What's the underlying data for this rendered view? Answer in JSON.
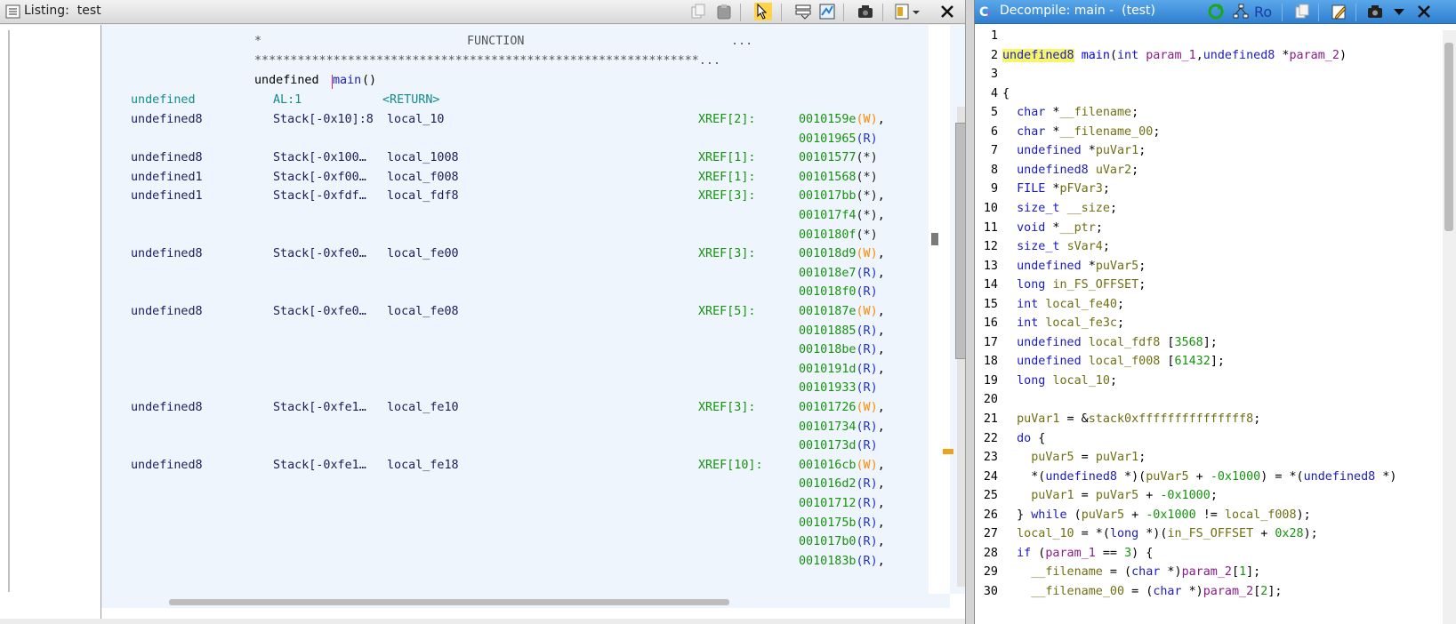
{
  "listing": {
    "title": "Listing:  test",
    "header": {
      "star": "*",
      "function_label": "FUNCTION",
      "ellipsis": "...",
      "stars": "**************************************************************...",
      "signature_ret": "undefined ",
      "signature_name": "main",
      "signature_params": "()"
    },
    "return_row": {
      "type": "undefined",
      "storage": "AL:1",
      "name": "<RETURN>"
    },
    "vars": [
      {
        "type": "undefined8",
        "stack": "Stack[-0x10]:8",
        "name": "local_10",
        "xref": "XREF[2]:",
        "refs": [
          {
            "addr": "0010159e",
            "acc": "(W)",
            "sep": ","
          },
          {
            "addr": "00101965",
            "acc": "(R)",
            "sep": ""
          }
        ]
      },
      {
        "type": "undefined8",
        "stack": "Stack[-0x100…",
        "name": "local_1008",
        "xref": "XREF[1]:",
        "refs": [
          {
            "addr": "00101577",
            "acc": "(*)",
            "sep": ""
          }
        ]
      },
      {
        "type": "undefined1",
        "stack": "Stack[-0xf00…",
        "name": "local_f008",
        "xref": "XREF[1]:",
        "refs": [
          {
            "addr": "00101568",
            "acc": "(*)",
            "sep": ""
          }
        ]
      },
      {
        "type": "undefined1",
        "stack": "Stack[-0xfdf…",
        "name": "local_fdf8",
        "xref": "XREF[3]:",
        "refs": [
          {
            "addr": "001017bb",
            "acc": "(*)",
            "sep": ","
          },
          {
            "addr": "001017f4",
            "acc": "(*)",
            "sep": ","
          },
          {
            "addr": "0010180f",
            "acc": "(*)",
            "sep": ""
          }
        ]
      },
      {
        "type": "undefined8",
        "stack": "Stack[-0xfe0…",
        "name": "local_fe00",
        "xref": "XREF[3]:",
        "refs": [
          {
            "addr": "001018d9",
            "acc": "(W)",
            "sep": ","
          },
          {
            "addr": "001018e7",
            "acc": "(R)",
            "sep": ","
          },
          {
            "addr": "001018f0",
            "acc": "(R)",
            "sep": ""
          }
        ]
      },
      {
        "type": "undefined8",
        "stack": "Stack[-0xfe0…",
        "name": "local_fe08",
        "xref": "XREF[5]:",
        "refs": [
          {
            "addr": "0010187e",
            "acc": "(W)",
            "sep": ","
          },
          {
            "addr": "00101885",
            "acc": "(R)",
            "sep": ","
          },
          {
            "addr": "001018be",
            "acc": "(R)",
            "sep": ","
          },
          {
            "addr": "0010191d",
            "acc": "(R)",
            "sep": ","
          },
          {
            "addr": "00101933",
            "acc": "(R)",
            "sep": ""
          }
        ]
      },
      {
        "type": "undefined8",
        "stack": "Stack[-0xfe1…",
        "name": "local_fe10",
        "xref": "XREF[3]:",
        "refs": [
          {
            "addr": "00101726",
            "acc": "(W)",
            "sep": ","
          },
          {
            "addr": "00101734",
            "acc": "(R)",
            "sep": ","
          },
          {
            "addr": "0010173d",
            "acc": "(R)",
            "sep": ""
          }
        ]
      },
      {
        "type": "undefined8",
        "stack": "Stack[-0xfe1…",
        "name": "local_fe18",
        "xref": "XREF[10]:",
        "refs": [
          {
            "addr": "001016cb",
            "acc": "(W)",
            "sep": ","
          },
          {
            "addr": "001016d2",
            "acc": "(R)",
            "sep": ","
          },
          {
            "addr": "00101712",
            "acc": "(R)",
            "sep": ","
          },
          {
            "addr": "0010175b",
            "acc": "(R)",
            "sep": ","
          },
          {
            "addr": "001017b0",
            "acc": "(R)",
            "sep": ","
          },
          {
            "addr": "0010183b",
            "acc": "(R)",
            "sep": ","
          }
        ]
      }
    ]
  },
  "decompile": {
    "title": "Decompile: main -  (test)",
    "lines": [
      "1",
      "2",
      "3",
      "4",
      "5",
      "6",
      "7",
      "8",
      "9",
      "10",
      "11",
      "12",
      "13",
      "14",
      "15",
      "16",
      "17",
      "18",
      "19",
      "20",
      "21",
      "22",
      "23",
      "24",
      "25",
      "26",
      "27",
      "28",
      "29",
      "30"
    ],
    "code": [
      [],
      [
        [
          "undefined8",
          "k hl"
        ],
        [
          " ",
          ""
        ],
        [
          "main",
          "f"
        ],
        [
          "(",
          ""
        ],
        [
          "int",
          "k"
        ],
        [
          " ",
          ""
        ],
        [
          "param_1",
          "p"
        ],
        [
          ",",
          ""
        ],
        [
          "undefined8",
          "k"
        ],
        [
          " *",
          ""
        ],
        [
          "param_2",
          "p"
        ],
        [
          ")",
          ""
        ]
      ],
      [],
      [
        [
          "{",
          ""
        ]
      ],
      [
        [
          "  ",
          ""
        ],
        [
          "char",
          "k"
        ],
        [
          " *",
          ""
        ],
        [
          "__filename",
          "v"
        ],
        [
          ";",
          ""
        ]
      ],
      [
        [
          "  ",
          ""
        ],
        [
          "char",
          "k"
        ],
        [
          " *",
          ""
        ],
        [
          "__filename_00",
          "v"
        ],
        [
          ";",
          ""
        ]
      ],
      [
        [
          "  ",
          ""
        ],
        [
          "undefined",
          "k"
        ],
        [
          " *",
          ""
        ],
        [
          "puVar1",
          "v"
        ],
        [
          ";",
          ""
        ]
      ],
      [
        [
          "  ",
          ""
        ],
        [
          "undefined8",
          "k"
        ],
        [
          " ",
          ""
        ],
        [
          "uVar2",
          "v"
        ],
        [
          ";",
          ""
        ]
      ],
      [
        [
          "  ",
          ""
        ],
        [
          "FILE",
          "k"
        ],
        [
          " *",
          ""
        ],
        [
          "pFVar3",
          "v"
        ],
        [
          ";",
          ""
        ]
      ],
      [
        [
          "  ",
          ""
        ],
        [
          "size_t",
          "k"
        ],
        [
          " ",
          ""
        ],
        [
          "__size",
          "v"
        ],
        [
          ";",
          ""
        ]
      ],
      [
        [
          "  ",
          ""
        ],
        [
          "void",
          "k"
        ],
        [
          " *",
          ""
        ],
        [
          "__ptr",
          "v"
        ],
        [
          ";",
          ""
        ]
      ],
      [
        [
          "  ",
          ""
        ],
        [
          "size_t",
          "k"
        ],
        [
          " ",
          ""
        ],
        [
          "sVar4",
          "v"
        ],
        [
          ";",
          ""
        ]
      ],
      [
        [
          "  ",
          ""
        ],
        [
          "undefined",
          "k"
        ],
        [
          " *",
          ""
        ],
        [
          "puVar5",
          "v"
        ],
        [
          ";",
          ""
        ]
      ],
      [
        [
          "  ",
          ""
        ],
        [
          "long",
          "k"
        ],
        [
          " ",
          ""
        ],
        [
          "in_FS_OFFSET",
          "v"
        ],
        [
          ";",
          ""
        ]
      ],
      [
        [
          "  ",
          ""
        ],
        [
          "int",
          "k"
        ],
        [
          " ",
          ""
        ],
        [
          "local_fe40",
          "v"
        ],
        [
          ";",
          ""
        ]
      ],
      [
        [
          "  ",
          ""
        ],
        [
          "int",
          "k"
        ],
        [
          " ",
          ""
        ],
        [
          "local_fe3c",
          "v"
        ],
        [
          ";",
          ""
        ]
      ],
      [
        [
          "  ",
          ""
        ],
        [
          "undefined",
          "k"
        ],
        [
          " ",
          ""
        ],
        [
          "local_fdf8",
          "v"
        ],
        [
          " [",
          ""
        ],
        [
          "3568",
          "n"
        ],
        [
          "];",
          ""
        ]
      ],
      [
        [
          "  ",
          ""
        ],
        [
          "undefined",
          "k"
        ],
        [
          " ",
          ""
        ],
        [
          "local_f008",
          "v"
        ],
        [
          " [",
          ""
        ],
        [
          "61432",
          "n"
        ],
        [
          "];",
          ""
        ]
      ],
      [
        [
          "  ",
          ""
        ],
        [
          "long",
          "k"
        ],
        [
          " ",
          ""
        ],
        [
          "local_10",
          "v"
        ],
        [
          ";",
          ""
        ]
      ],
      [],
      [
        [
          "  ",
          ""
        ],
        [
          "puVar1",
          "v"
        ],
        [
          " = &",
          ""
        ],
        [
          "stack0xfffffffffffffff8",
          "v"
        ],
        [
          ";",
          ""
        ]
      ],
      [
        [
          "  ",
          ""
        ],
        [
          "do",
          "k"
        ],
        [
          " {",
          ""
        ]
      ],
      [
        [
          "    ",
          ""
        ],
        [
          "puVar5",
          "v"
        ],
        [
          " = ",
          ""
        ],
        [
          "puVar1",
          "v"
        ],
        [
          ";",
          ""
        ]
      ],
      [
        [
          "    *(",
          ""
        ],
        [
          "undefined8",
          "k"
        ],
        [
          " *)(",
          ""
        ],
        [
          "puVar5",
          "v"
        ],
        [
          " + ",
          ""
        ],
        [
          "-0x1000",
          "n"
        ],
        [
          ") = *(",
          ""
        ],
        [
          "undefined8",
          "k"
        ],
        [
          " *)",
          ""
        ]
      ],
      [
        [
          "    ",
          ""
        ],
        [
          "puVar1",
          "v"
        ],
        [
          " = ",
          ""
        ],
        [
          "puVar5",
          "v"
        ],
        [
          " + ",
          ""
        ],
        [
          "-0x1000",
          "n"
        ],
        [
          ";",
          ""
        ]
      ],
      [
        [
          "  } ",
          ""
        ],
        [
          "while",
          "k"
        ],
        [
          " (",
          ""
        ],
        [
          "puVar5",
          "v"
        ],
        [
          " + ",
          ""
        ],
        [
          "-0x1000",
          "n"
        ],
        [
          " != ",
          ""
        ],
        [
          "local_f008",
          "v"
        ],
        [
          ");",
          ""
        ]
      ],
      [
        [
          "  ",
          ""
        ],
        [
          "local_10",
          "v"
        ],
        [
          " = *(",
          ""
        ],
        [
          "long",
          "k"
        ],
        [
          " *)(",
          ""
        ],
        [
          "in_FS_OFFSET",
          "v"
        ],
        [
          " + ",
          ""
        ],
        [
          "0x28",
          "n"
        ],
        [
          ");",
          ""
        ]
      ],
      [
        [
          "  ",
          ""
        ],
        [
          "if",
          "k"
        ],
        [
          " (",
          ""
        ],
        [
          "param_1",
          "p"
        ],
        [
          " == ",
          ""
        ],
        [
          "3",
          "n"
        ],
        [
          ") {",
          ""
        ]
      ],
      [
        [
          "    ",
          ""
        ],
        [
          "__filename",
          "v"
        ],
        [
          " = (",
          ""
        ],
        [
          "char",
          "k"
        ],
        [
          " *)",
          ""
        ],
        [
          "param_2",
          "p"
        ],
        [
          "[",
          ""
        ],
        [
          "1",
          "n"
        ],
        [
          "];",
          ""
        ]
      ],
      [
        [
          "    ",
          ""
        ],
        [
          "__filename_00",
          "v"
        ],
        [
          " = (",
          ""
        ],
        [
          "char",
          "k"
        ],
        [
          " *)",
          ""
        ],
        [
          "param_2",
          "p"
        ],
        [
          "[",
          ""
        ],
        [
          "2",
          "n"
        ],
        [
          "];",
          ""
        ]
      ]
    ]
  }
}
